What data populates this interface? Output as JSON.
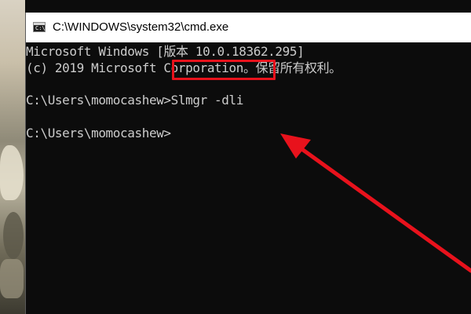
{
  "window": {
    "title": "C:\\WINDOWS\\system32\\cmd.exe",
    "icon": "terminal-icon"
  },
  "console": {
    "lines": [
      "Microsoft Windows [版本 10.0.18362.295]",
      "(c) 2019 Microsoft Corporation。保留所有权利。",
      "",
      "C:\\Users\\momocashew>Slmgr -dli",
      "",
      "C:\\Users\\momocashew>"
    ]
  },
  "annotation": {
    "highlight_color": "#e8121c",
    "arrow_color": "#e8121c"
  }
}
